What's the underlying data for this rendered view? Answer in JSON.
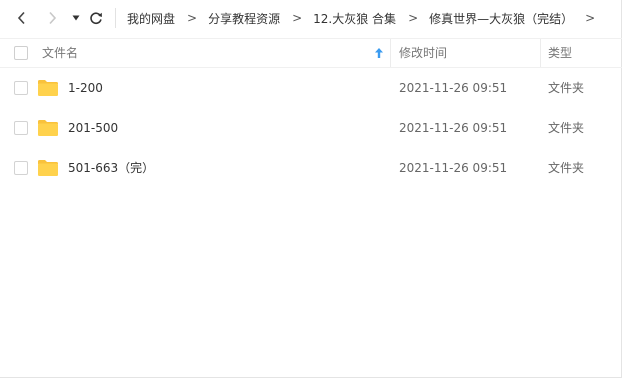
{
  "toolbar": {
    "back_icon": "chevron-left-icon",
    "forward_icon": "chevron-right-icon",
    "history_icon": "caret-down-icon",
    "refresh_icon": "refresh-icon"
  },
  "breadcrumb": {
    "items": [
      "我的网盘",
      "分享教程资源",
      "12.大灰狼 合集",
      "修真世界—大灰狼（完结）"
    ],
    "separator": ">"
  },
  "list_header": {
    "name_label": "文件名",
    "date_label": "修改时间",
    "type_label": "类型",
    "sort_icon": "sort-ascending-arrow-icon"
  },
  "files": [
    {
      "name": "1-200",
      "date": "2021-11-26 09:51",
      "type": "文件夹"
    },
    {
      "name": "201-500",
      "date": "2021-11-26 09:51",
      "type": "文件夹"
    },
    {
      "name": "501-663（完）",
      "date": "2021-11-26 09:51",
      "type": "文件夹"
    }
  ],
  "colors": {
    "folder": "#FFD24D",
    "folder_tab": "#F9C23C",
    "sort_arrow": "#3A9BF0",
    "text": "#333333",
    "muted_text": "#777777"
  }
}
